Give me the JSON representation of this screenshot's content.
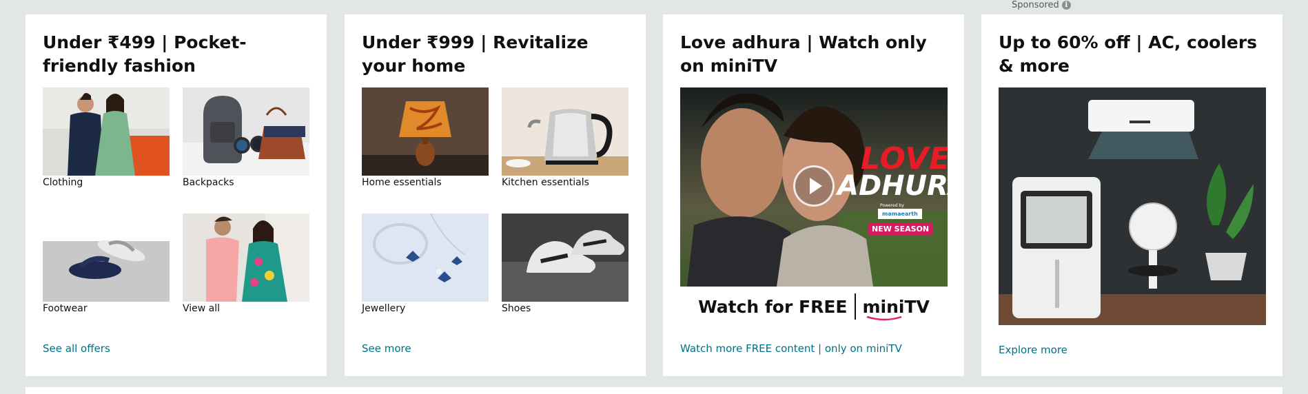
{
  "sponsored_label": "Sponsored",
  "cards": [
    {
      "title": "Under ₹499 | Pocket-friendly fashion",
      "items": [
        {
          "label": "Clothing"
        },
        {
          "label": "Backpacks"
        },
        {
          "label": "Footwear"
        },
        {
          "label": "View all"
        }
      ],
      "link": "See all offers"
    },
    {
      "title": "Under ₹999 | Revitalize your home",
      "items": [
        {
          "label": "Home essentials"
        },
        {
          "label": "Kitchen essentials"
        },
        {
          "label": "Jewellery"
        },
        {
          "label": "Shoes"
        }
      ],
      "link": "See more"
    },
    {
      "title": "Love adhura | Watch only on miniTV",
      "banner": {
        "show_title_1": "LOVE",
        "show_title_2": "ADHURA",
        "powered_by": "Powered by",
        "sponsor": "mamaearth",
        "season_badge": "NEW SEASON",
        "watch_text": "Watch for FREE",
        "brand": "miniTV"
      },
      "link": "Watch more FREE content | only on miniTV"
    },
    {
      "title": "Up to 60% off | AC, coolers & more",
      "link": "Explore more"
    }
  ]
}
